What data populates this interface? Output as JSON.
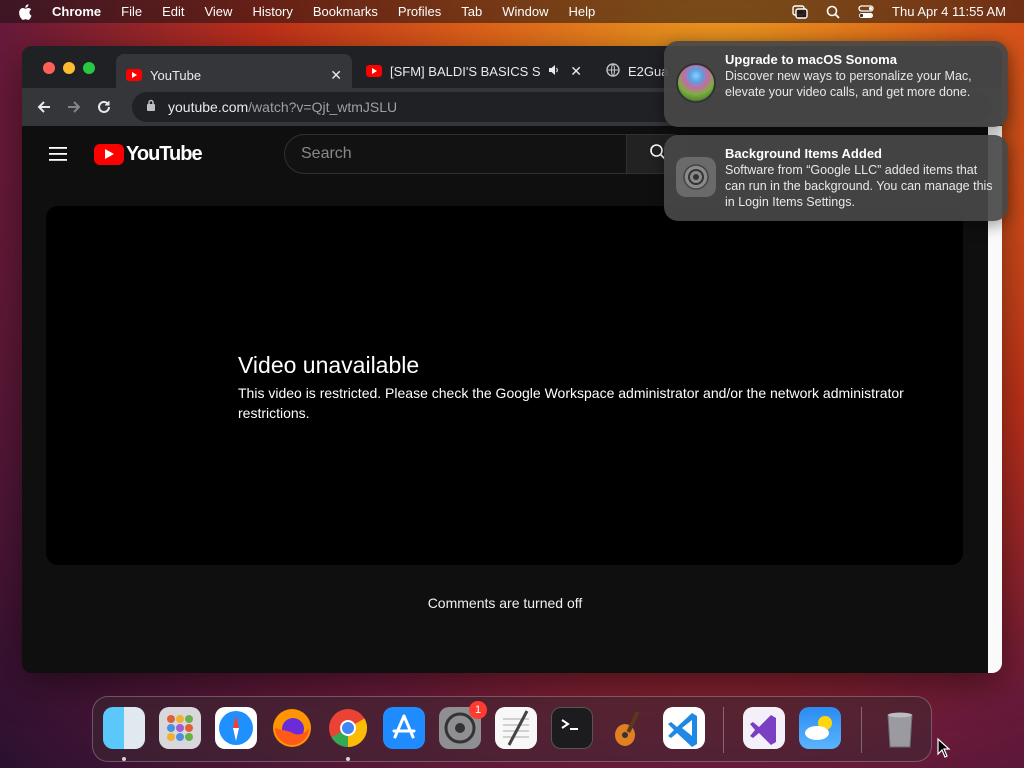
{
  "menubar": {
    "app_name": "Chrome",
    "items": [
      "File",
      "Edit",
      "View",
      "History",
      "Bookmarks",
      "Profiles",
      "Tab",
      "Window",
      "Help"
    ],
    "clock": "Thu Apr 4  11:55 AM"
  },
  "browser": {
    "tabs": [
      {
        "title": "YouTube",
        "active": true
      },
      {
        "title": "[SFM] BALDI'S BASICS SO",
        "active": false,
        "audio": true
      },
      {
        "title": "E2Gua",
        "active": false
      }
    ],
    "url_host": "youtube.com",
    "url_path": "/watch?v=Qjt_wtmJSLU"
  },
  "youtube": {
    "logo_text": "YouTube",
    "search_placeholder": "Search",
    "player": {
      "heading": "Video unavailable",
      "message": "This video is restricted. Please check the Google Workspace administrator and/or the network administrator restrictions."
    },
    "comments_text": "Comments are turned off"
  },
  "notifications": [
    {
      "title": "Upgrade to macOS Sonoma",
      "body": "Discover new ways to personalize your Mac, elevate your video calls, and get more done."
    },
    {
      "title": "Background Items Added",
      "body": "Software from “Google LLC” added items that can run in the background. You can manage this in Login Items Settings."
    }
  ],
  "dock": {
    "apps": [
      "finder",
      "launchpad",
      "safari",
      "firefox",
      "chrome",
      "app-store",
      "system-settings",
      "textedit",
      "terminal",
      "garageband",
      "vscode",
      "visual-studio",
      "weather",
      "trash"
    ],
    "settings_badge": "1"
  },
  "colors": {
    "youtube_red": "#ff0000",
    "page_bg": "#0f0f0f",
    "tab_bg": "#202124",
    "badge_red": "#ff3b30"
  }
}
